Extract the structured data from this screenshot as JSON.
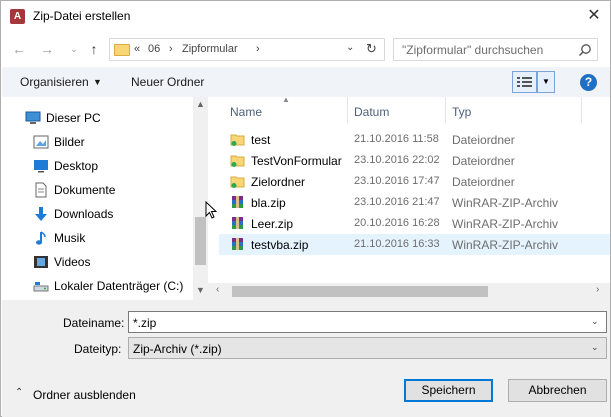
{
  "window": {
    "title": "Zip-Datei erstellen",
    "app_icon_letter": "A"
  },
  "nav": {
    "breadcrumb": [
      "06",
      "Zipformular"
    ],
    "overflow": "«",
    "search_placeholder": "\"Zipformular\" durchsuchen"
  },
  "toolbar": {
    "organize_label": "Organisieren",
    "new_folder_label": "Neuer Ordner"
  },
  "sidebar": {
    "items": [
      {
        "label": "Dieser PC",
        "icon": "pc-icon"
      },
      {
        "label": "Bilder",
        "icon": "pictures-icon"
      },
      {
        "label": "Desktop",
        "icon": "desktop-icon"
      },
      {
        "label": "Dokumente",
        "icon": "documents-icon"
      },
      {
        "label": "Downloads",
        "icon": "downloads-icon"
      },
      {
        "label": "Musik",
        "icon": "music-icon"
      },
      {
        "label": "Videos",
        "icon": "videos-icon"
      },
      {
        "label": "Lokaler Datenträger (C:)",
        "icon": "drive-icon"
      }
    ]
  },
  "filelist": {
    "columns": [
      "Name",
      "Datum",
      "Typ"
    ],
    "rows": [
      {
        "name": "test",
        "date": "21.10.2016 11:58",
        "type": "Dateiordner",
        "kind": "folder"
      },
      {
        "name": "TestVonFormular",
        "date": "23.10.2016 22:02",
        "type": "Dateiordner",
        "kind": "folder"
      },
      {
        "name": "Zielordner",
        "date": "23.10.2016 17:47",
        "type": "Dateiordner",
        "kind": "folder"
      },
      {
        "name": "bla.zip",
        "date": "23.10.2016 21:47",
        "type": "WinRAR-ZIP-Archiv",
        "kind": "zip"
      },
      {
        "name": "Leer.zip",
        "date": "20.10.2016 16:28",
        "type": "WinRAR-ZIP-Archiv",
        "kind": "zip"
      },
      {
        "name": "testvba.zip",
        "date": "21.10.2016 16:33",
        "type": "WinRAR-ZIP-Archiv",
        "kind": "zip",
        "selected": true
      }
    ]
  },
  "form": {
    "filename_label": "Dateiname:",
    "filename_value": "*.zip",
    "filetype_label": "Dateityp:",
    "filetype_value": "Zip-Archiv (*.zip)"
  },
  "footer": {
    "hide_folders_label": "Ordner ausblenden",
    "save_label": "Speichern",
    "cancel_label": "Abbrechen"
  },
  "colors": {
    "accent": "#0078d7",
    "selection": "#e5f3ff",
    "toolbar_bg": "#f0f4f9",
    "bottom_bg": "#f0f0f0"
  }
}
